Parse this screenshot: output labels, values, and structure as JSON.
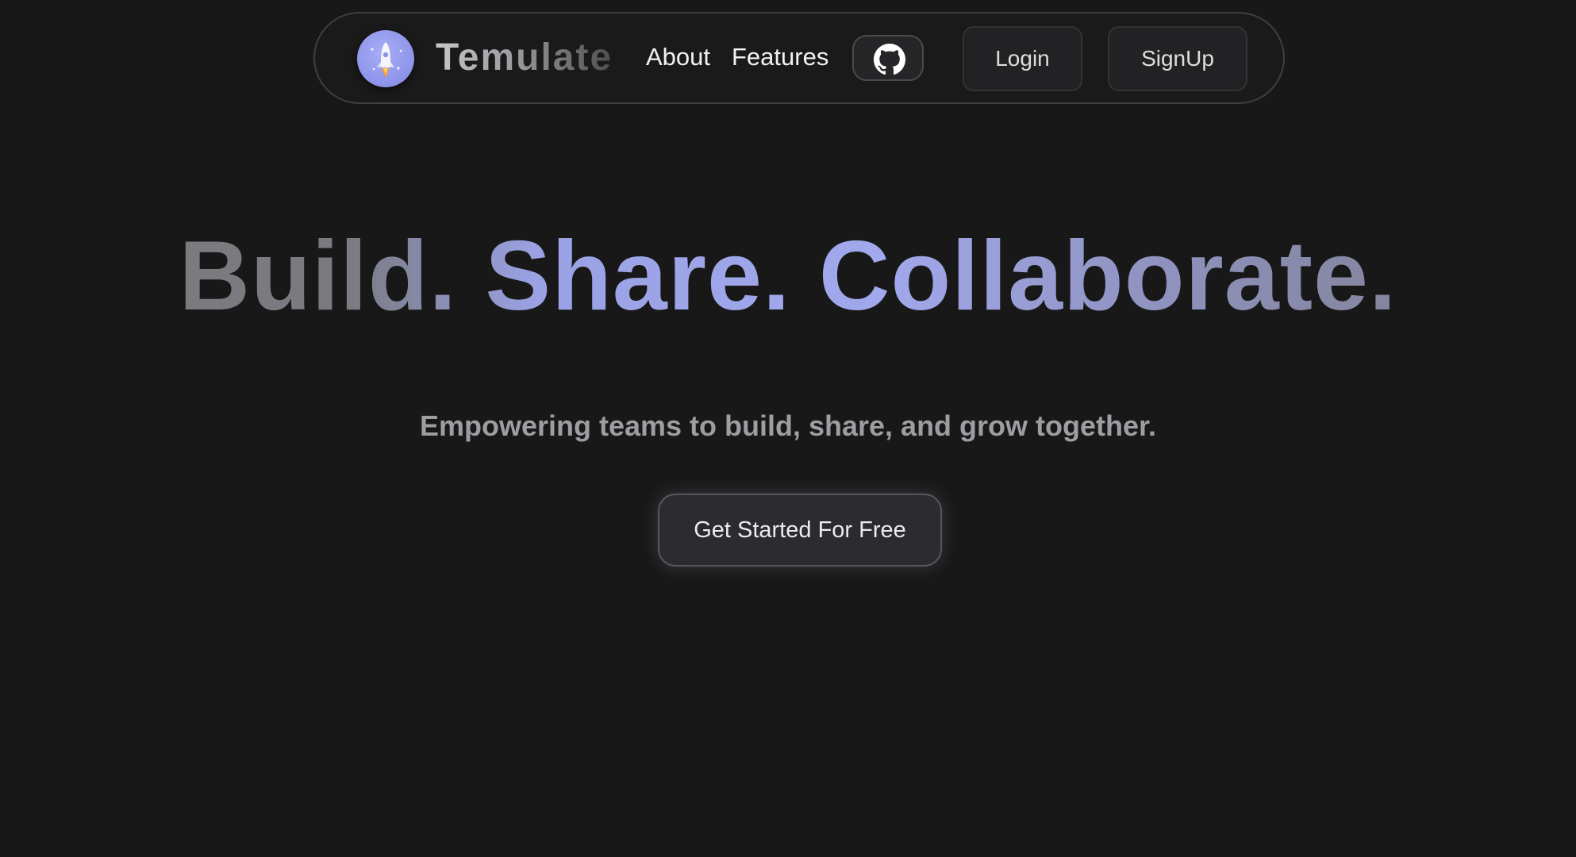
{
  "navbar": {
    "brand": "Temulate",
    "logo_icon": "rocket-icon",
    "links": {
      "about": "About",
      "features": "Features"
    },
    "github_icon": "github-icon",
    "login_label": "Login",
    "signup_label": "SignUp"
  },
  "hero": {
    "title": "Build. Share. Collaborate.",
    "subtitle": "Empowering teams to build, share, and grow together.",
    "cta_label": "Get Started For Free"
  },
  "colors": {
    "background": "#181818",
    "accent": "#a1a8ec",
    "logo_bg": "#8c93ea"
  }
}
